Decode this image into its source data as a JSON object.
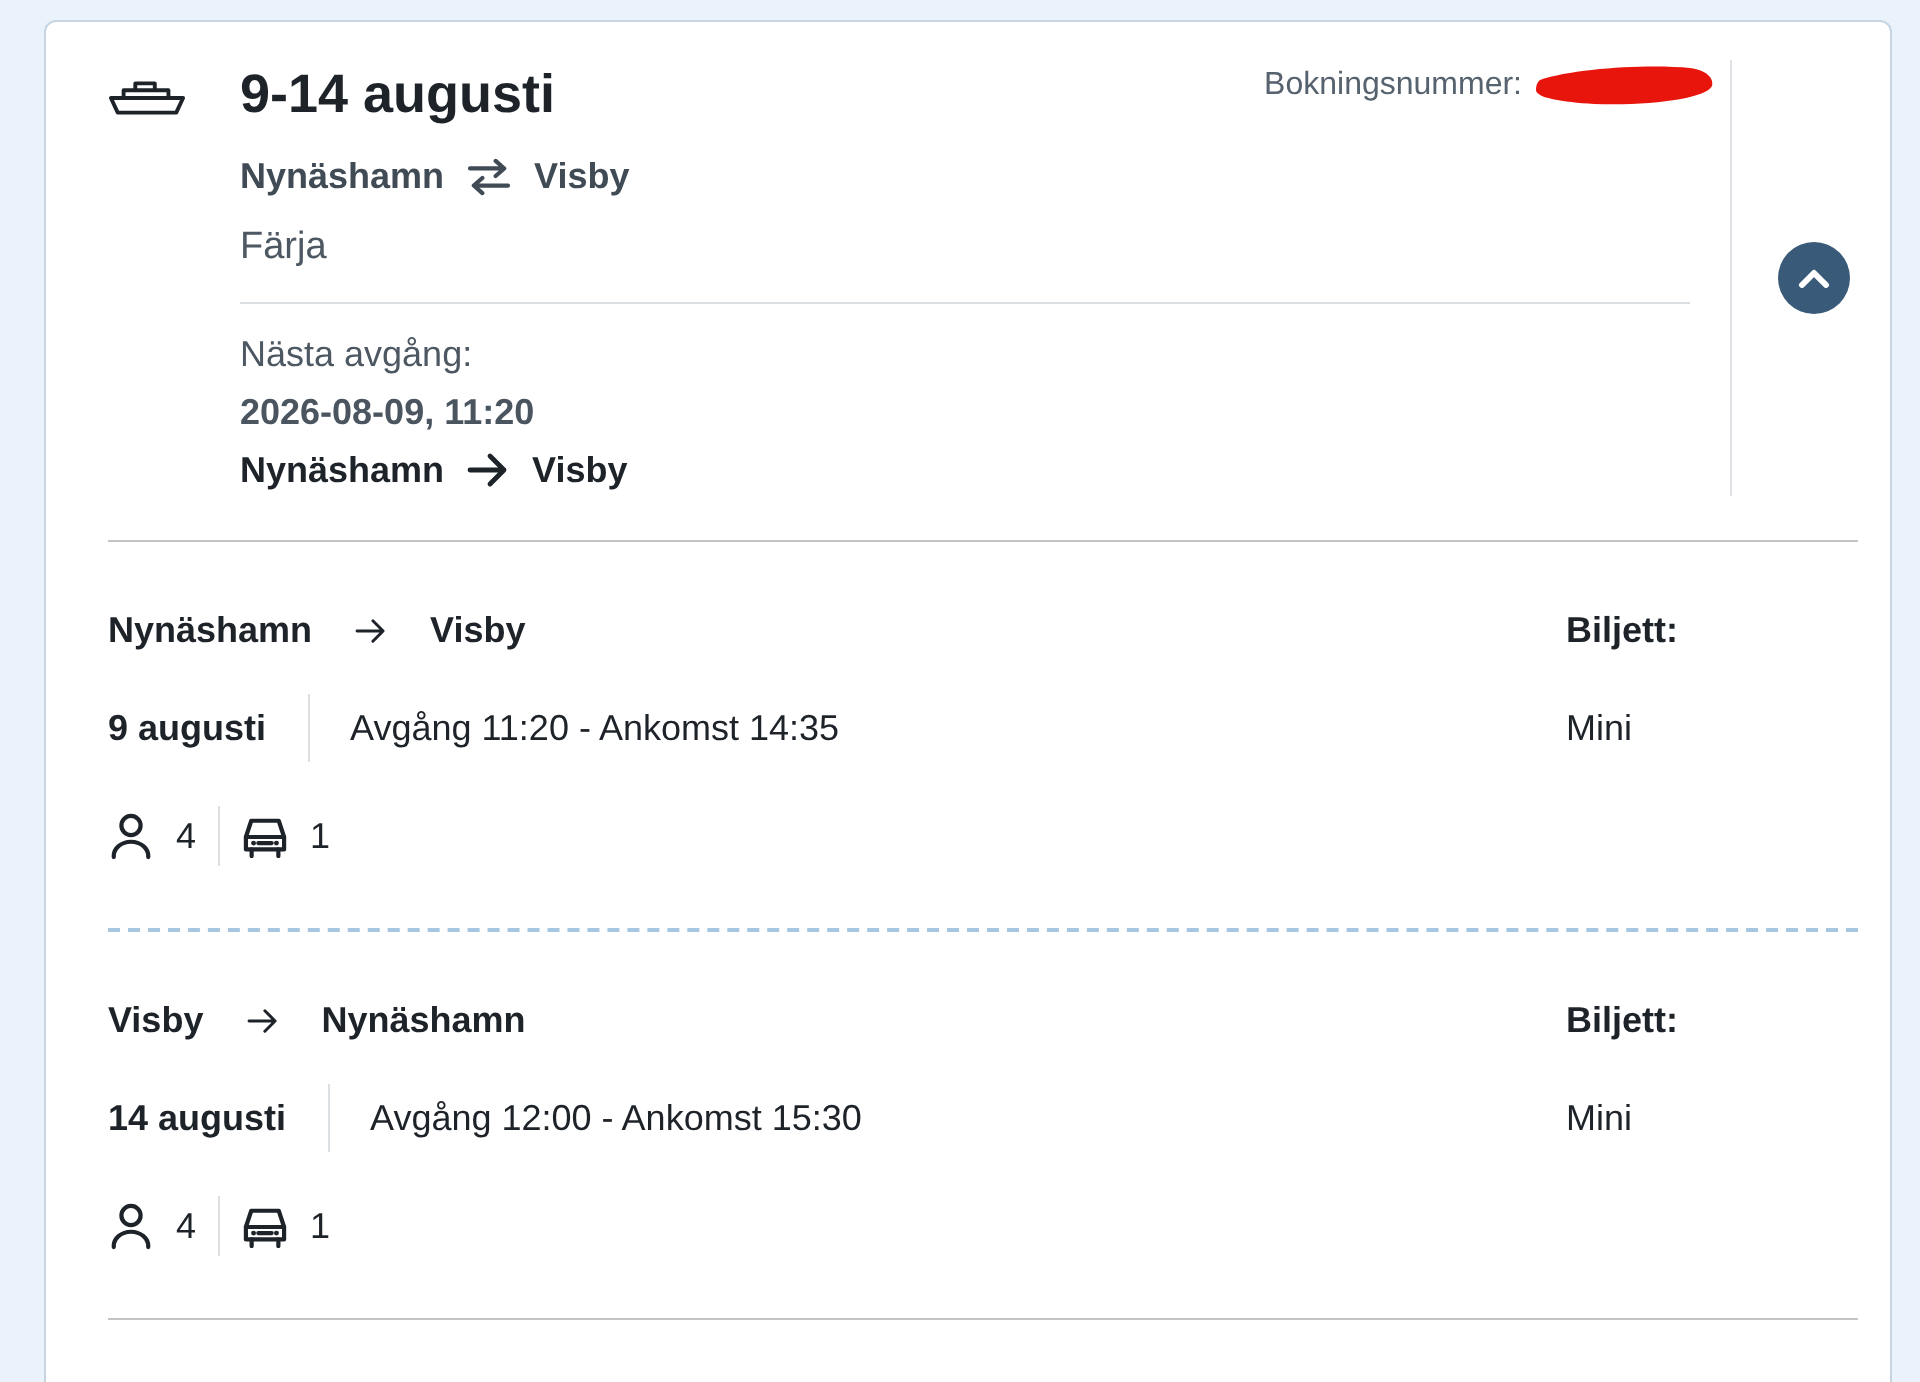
{
  "booking": {
    "title": "9-14 augusti",
    "booking_number_label": "Bokningsnummer:",
    "route": {
      "from": "Nynäshamn",
      "to": "Visby"
    },
    "mode": "Färja",
    "next_departure": {
      "label": "Nästa avgång:",
      "datetime": "2026-08-09, 11:20",
      "from": "Nynäshamn",
      "to": "Visby"
    },
    "expanded": true
  },
  "legs": [
    {
      "from": "Nynäshamn",
      "to": "Visby",
      "ticket_label": "Biljett:",
      "date": "9 augusti",
      "times": "Avgång 11:20 - Ankomst 14:35",
      "ticket": "Mini",
      "passengers": "4",
      "vehicles": "1"
    },
    {
      "from": "Visby",
      "to": "Nynäshamn",
      "ticket_label": "Biljett:",
      "date": "14 augusti",
      "times": "Avgång 12:00 - Ankomst 15:30",
      "ticket": "Mini",
      "passengers": "4",
      "vehicles": "1"
    }
  ]
}
